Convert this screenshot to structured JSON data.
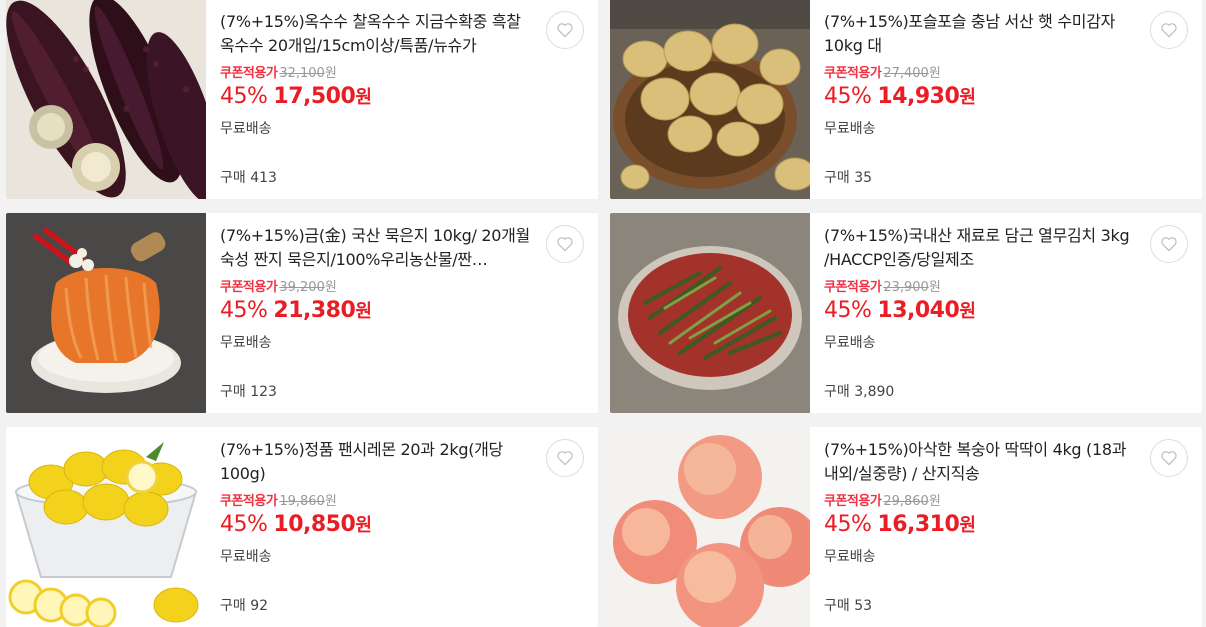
{
  "products": [
    {
      "image": "purple-corn-photo",
      "title": "(7%+15%)옥수수 찰옥수수 지금수확중 흑찰옥수수 20개입/15cm이상/특품/뉴슈가",
      "coupon_label": "쿠폰적용가",
      "original_price": "32,100",
      "original_unit": "원",
      "discount_rate": "45%",
      "price": "17,500",
      "price_unit": "원",
      "shipping": "무료배송",
      "sold": "구매 413"
    },
    {
      "image": "potatoes-basket-photo",
      "title": "(7%+15%)포슬포슬 충남 서산 햇 수미감자 10kg 대",
      "coupon_label": "쿠폰적용가",
      "original_price": "27,400",
      "original_unit": "원",
      "discount_rate": "45%",
      "price": "14,930",
      "price_unit": "원",
      "shipping": "무료배송",
      "sold": "구매 35"
    },
    {
      "image": "aged-kimchi-photo",
      "title": "(7%+15%)금(金) 국산 묵은지 10kg/ 20개월 숙성 짠지 묵은지/100%우리농산물/짠…",
      "coupon_label": "쿠폰적용가",
      "original_price": "39,200",
      "original_unit": "원",
      "discount_rate": "45%",
      "price": "21,380",
      "price_unit": "원",
      "shipping": "무료배송",
      "sold": "구매 123"
    },
    {
      "image": "young-radish-kimchi-photo",
      "title": "(7%+15%)국내산 재료로 담근 열무김치 3kg /HACCP인증/당일제조",
      "coupon_label": "쿠폰적용가",
      "original_price": "23,900",
      "original_unit": "원",
      "discount_rate": "45%",
      "price": "13,040",
      "price_unit": "원",
      "shipping": "무료배송",
      "sold": "구매 3,890"
    },
    {
      "image": "lemons-bowl-photo",
      "title": "(7%+15%)정품 팬시레몬 20과 2kg(개당100g)",
      "coupon_label": "쿠폰적용가",
      "original_price": "19,860",
      "original_unit": "원",
      "discount_rate": "45%",
      "price": "10,850",
      "price_unit": "원",
      "shipping": "무료배송",
      "sold": "구매 92"
    },
    {
      "image": "peaches-photo",
      "title": "(7%+15%)아삭한 복숭아 딱딱이 4kg (18과 내외/실중량) / 산지직송",
      "coupon_label": "쿠폰적용가",
      "original_price": "29,860",
      "original_unit": "원",
      "discount_rate": "45%",
      "price": "16,310",
      "price_unit": "원",
      "shipping": "무료배송",
      "sold": "구매 53"
    }
  ],
  "icons": {
    "wishlist": "heart-outline-icon"
  },
  "colors": {
    "sale_red": "#ea1c24",
    "coupon_red": "#f43142",
    "muted": "#999999"
  }
}
